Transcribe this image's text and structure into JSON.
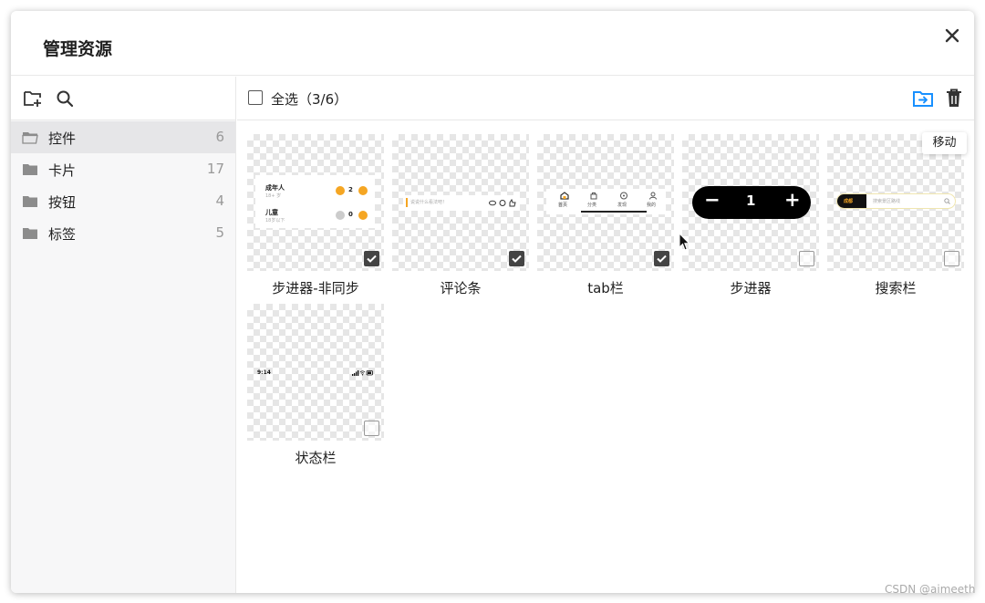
{
  "modal": {
    "title": "管理资源"
  },
  "sidebar": {
    "folders": [
      {
        "name": "控件",
        "count": "6"
      },
      {
        "name": "卡片",
        "count": "17"
      },
      {
        "name": "按钮",
        "count": "4"
      },
      {
        "name": "标签",
        "count": "5"
      }
    ]
  },
  "toolbar": {
    "select_all_label": "全选（3/6）",
    "move_tooltip": "移动"
  },
  "assets": [
    {
      "label": "步进器-非同步",
      "checked": true
    },
    {
      "label": "评论条",
      "checked": true
    },
    {
      "label": "tab栏",
      "checked": true
    },
    {
      "label": "步进器",
      "checked": false
    },
    {
      "label": "搜索栏",
      "checked": false
    },
    {
      "label": "状态栏",
      "checked": false
    }
  ],
  "previews": {
    "stepper_async": {
      "row1_title": "成年人",
      "row1_sub": "18+ 岁",
      "row1_value": "2",
      "row2_title": "儿童",
      "row2_sub": "18岁以下",
      "row2_value": "0"
    },
    "comment": {
      "placeholder": "说说什么看法吧！"
    },
    "tabbar": {
      "tabs": [
        "首页",
        "分类",
        "发现",
        "我的"
      ]
    },
    "stepper": {
      "minus": "−",
      "value": "1",
      "plus": "+"
    },
    "search": {
      "city": "成都",
      "placeholder": "搜索景区路线"
    },
    "status": {
      "time": "9:14"
    }
  },
  "colors": {
    "accent": "#1890ff",
    "stepper_orange": "#f5a623"
  },
  "watermark": "CSDN @aimeeth"
}
